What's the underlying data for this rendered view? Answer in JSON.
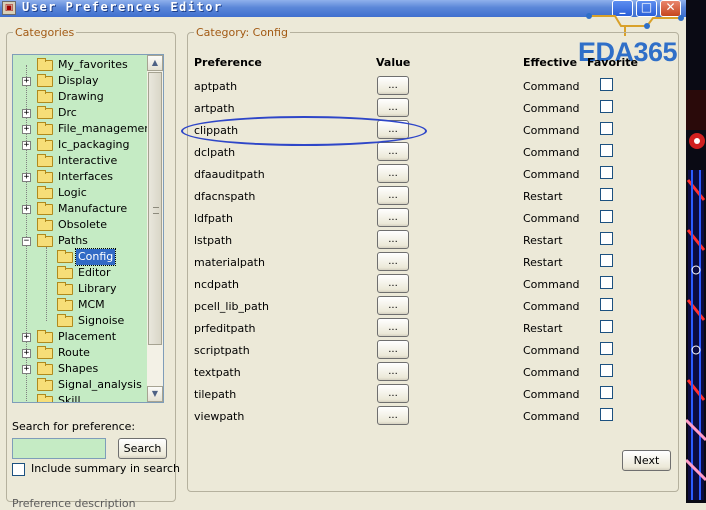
{
  "window": {
    "title": "User Preferences Editor",
    "logo_text": "EDA365",
    "colors": {
      "titlebar": "#3f6fcf",
      "logo": "#2f6fc8",
      "tree_bg": "#c5ebc4",
      "accent_legend": "#a25a14",
      "highlight": "#2e46c8"
    }
  },
  "categories": {
    "legend": "Categories",
    "items": [
      {
        "label": "My_favorites",
        "expander": ""
      },
      {
        "label": "Display",
        "expander": "+"
      },
      {
        "label": "Drawing",
        "expander": ""
      },
      {
        "label": "Drc",
        "expander": "+"
      },
      {
        "label": "File_management",
        "expander": "+"
      },
      {
        "label": "Ic_packaging",
        "expander": "+"
      },
      {
        "label": "Interactive",
        "expander": ""
      },
      {
        "label": "Interfaces",
        "expander": "+"
      },
      {
        "label": "Logic",
        "expander": ""
      },
      {
        "label": "Manufacture",
        "expander": "+"
      },
      {
        "label": "Obsolete",
        "expander": ""
      },
      {
        "label": "Paths",
        "expander": "−"
      },
      {
        "label": "Config",
        "expander": "",
        "child": true,
        "selected": true
      },
      {
        "label": "Editor",
        "expander": "",
        "child": true
      },
      {
        "label": "Library",
        "expander": "",
        "child": true
      },
      {
        "label": "MCM",
        "expander": "",
        "child": true
      },
      {
        "label": "Signoise",
        "expander": "",
        "child": true
      },
      {
        "label": "Placement",
        "expander": "+"
      },
      {
        "label": "Route",
        "expander": "+"
      },
      {
        "label": "Shapes",
        "expander": "+"
      },
      {
        "label": "Signal_analysis",
        "expander": ""
      },
      {
        "label": "Skill",
        "expander": ""
      }
    ],
    "search_label": "Search for preference:",
    "search_value": "",
    "search_button": "Search",
    "include_summary_label": "Include summary in search",
    "include_summary_checked": false,
    "description_legend": "Preference description"
  },
  "main": {
    "legend": "Category:  Config",
    "headers": {
      "preference": "Preference",
      "value": "Value",
      "effective": "Effective",
      "favorite": "Favorite"
    },
    "rows": [
      {
        "name": "aptpath",
        "value_button": "...",
        "effective": "Command",
        "favorite": false
      },
      {
        "name": "artpath",
        "value_button": "...",
        "effective": "Command",
        "favorite": false
      },
      {
        "name": "clippath",
        "value_button": "...",
        "effective": "Command",
        "favorite": false
      },
      {
        "name": "dclpath",
        "value_button": "...",
        "effective": "Command",
        "favorite": false
      },
      {
        "name": "dfaauditpath",
        "value_button": "...",
        "effective": "Command",
        "favorite": false
      },
      {
        "name": "dfacnspath",
        "value_button": "...",
        "effective": "Restart",
        "favorite": false
      },
      {
        "name": "ldfpath",
        "value_button": "...",
        "effective": "Command",
        "favorite": false
      },
      {
        "name": "lstpath",
        "value_button": "...",
        "effective": "Restart",
        "favorite": false
      },
      {
        "name": "materialpath",
        "value_button": "...",
        "effective": "Restart",
        "favorite": false
      },
      {
        "name": "ncdpath",
        "value_button": "...",
        "effective": "Command",
        "favorite": false
      },
      {
        "name": "pcell_lib_path",
        "value_button": "...",
        "effective": "Command",
        "favorite": false
      },
      {
        "name": "prfeditpath",
        "value_button": "...",
        "effective": "Restart",
        "favorite": false
      },
      {
        "name": "scriptpath",
        "value_button": "...",
        "effective": "Command",
        "favorite": false
      },
      {
        "name": "textpath",
        "value_button": "...",
        "effective": "Command",
        "favorite": false
      },
      {
        "name": "tilepath",
        "value_button": "...",
        "effective": "Command",
        "favorite": false
      },
      {
        "name": "viewpath",
        "value_button": "...",
        "effective": "Command",
        "favorite": false
      }
    ],
    "highlighted_row": "clippath",
    "next_button": "Next"
  }
}
